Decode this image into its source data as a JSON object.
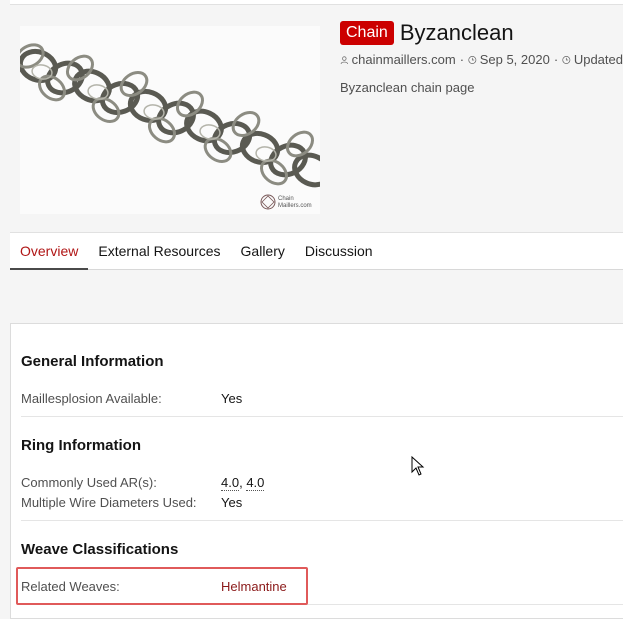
{
  "header": {
    "badge": "Chain",
    "title": "Byzanclean",
    "meta": {
      "author": "chainmaillers.com",
      "date": "Sep 5, 2020",
      "updated": "Updated"
    },
    "description": "Byzanclean chain page"
  },
  "tabs": [
    {
      "label": "Overview",
      "active": true
    },
    {
      "label": "External Resources",
      "active": false
    },
    {
      "label": "Gallery",
      "active": false
    },
    {
      "label": "Discussion",
      "active": false
    }
  ],
  "sections": {
    "general": {
      "title": "General Information",
      "rows": [
        {
          "label": "Maillesplosion Available:",
          "value": "Yes"
        }
      ]
    },
    "ring": {
      "title": "Ring Information",
      "ar_label": "Commonly Used AR(s):",
      "ar_values": [
        "4.0",
        "4.0"
      ],
      "wire_label": "Multiple Wire Diameters Used:",
      "wire_value": "Yes"
    },
    "weave": {
      "title": "Weave Classifications",
      "related_label": "Related Weaves:",
      "related_value": "Helmantine"
    }
  },
  "image_watermark": "Chain Maillers.com",
  "colors": {
    "badge_bg": "#cc0000",
    "link": "#8b1a1a",
    "active_tab": "#b01515",
    "highlight": "#e05a5a"
  }
}
